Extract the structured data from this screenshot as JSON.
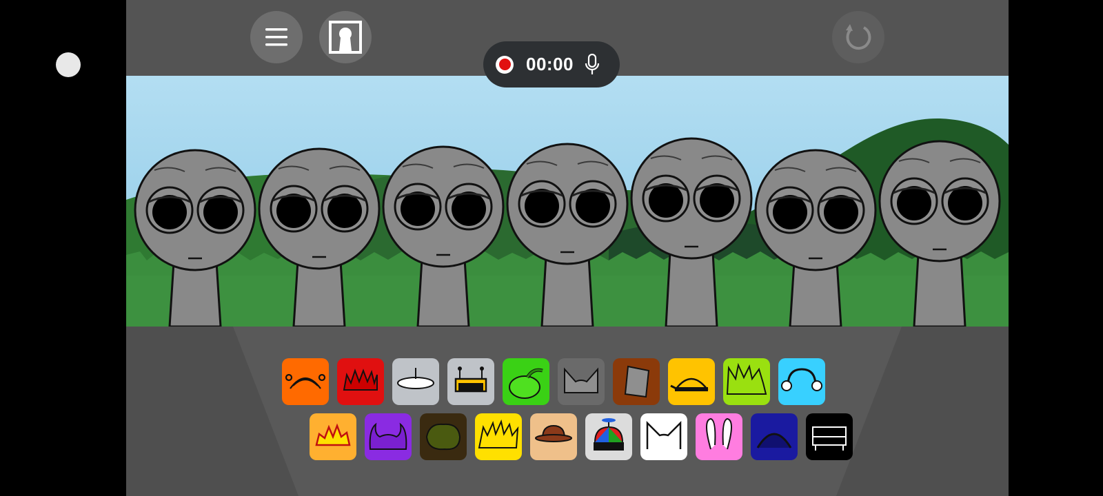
{
  "recorder": {
    "time": "00:00"
  },
  "colors": {
    "background": "#000000",
    "game_bg": "#555555",
    "sky": "#a8d8ef",
    "grass": "#3b8e3e",
    "character": "#898989"
  },
  "characters": [
    {
      "name": "character-1"
    },
    {
      "name": "character-2"
    },
    {
      "name": "character-3"
    },
    {
      "name": "character-4"
    },
    {
      "name": "character-5"
    },
    {
      "name": "character-6"
    },
    {
      "name": "character-7"
    }
  ],
  "palette": {
    "row1": [
      {
        "icon": "antenna-headband-icon",
        "color": "#ff6a00"
      },
      {
        "icon": "spiky-crown-icon",
        "color": "#e01010"
      },
      {
        "icon": "halo-plate-icon",
        "color": "#bfc3c8"
      },
      {
        "icon": "antenna-box-icon",
        "color": "#bfc3c8"
      },
      {
        "icon": "pumpkin-icon",
        "color": "#3ad115"
      },
      {
        "icon": "cat-ears-icon",
        "color": "#6a6a6a"
      },
      {
        "icon": "bucket-icon",
        "color": "#8b3a0a"
      },
      {
        "icon": "dome-cap-icon",
        "color": "#ffc300"
      },
      {
        "icon": "spiky-hair-icon",
        "color": "#9ae010"
      },
      {
        "icon": "headphones-icon",
        "color": "#38d0ff"
      }
    ],
    "row2": [
      {
        "icon": "burst-crown-icon",
        "color": "#ffb030"
      },
      {
        "icon": "horns-icon",
        "color": "#8a2be2"
      },
      {
        "icon": "mossy-hair-icon",
        "color": "#3a2a10"
      },
      {
        "icon": "lightning-hair-icon",
        "color": "#ffe000"
      },
      {
        "icon": "fedora-icon",
        "color": "#efc08a"
      },
      {
        "icon": "propeller-cap-icon",
        "color": "#dcdcdc"
      },
      {
        "icon": "white-cat-ears-icon",
        "color": "#ffffff"
      },
      {
        "icon": "bunny-ears-icon",
        "color": "#ff7de0"
      },
      {
        "icon": "dark-dome-icon",
        "color": "#1a1aa0"
      },
      {
        "icon": "bench-icon",
        "color": "#000000"
      }
    ]
  }
}
